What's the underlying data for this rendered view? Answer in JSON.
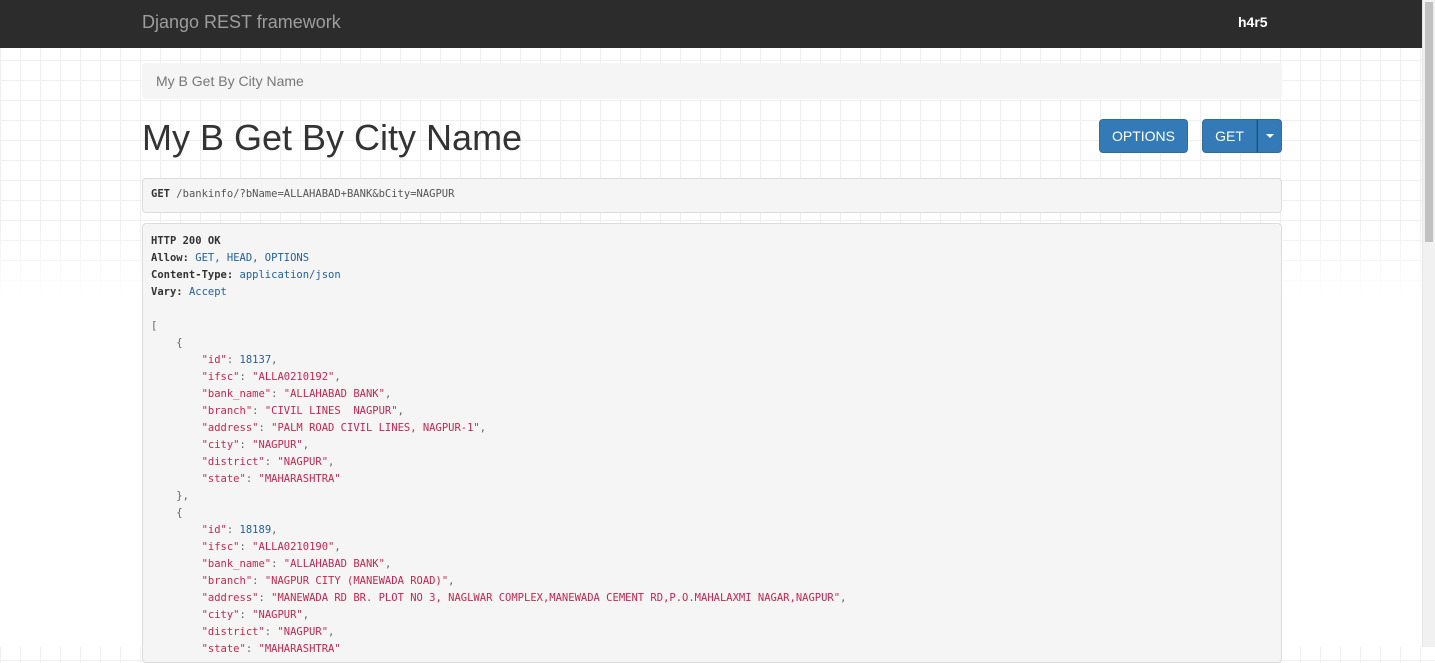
{
  "navbar": {
    "brand": "Django REST framework",
    "user": "h4r5"
  },
  "breadcrumb": {
    "label": "My B Get By City Name"
  },
  "page": {
    "title": "My B Get By City Name"
  },
  "buttons": {
    "options": "OPTIONS",
    "get": "GET"
  },
  "request": {
    "method": "GET",
    "url": "/bankinfo/?bName=ALLAHABAD+BANK&bCity=NAGPUR"
  },
  "response": {
    "status": "HTTP 200 OK",
    "headers": [
      {
        "key": "Allow:",
        "value": "GET, HEAD, OPTIONS"
      },
      {
        "key": "Content-Type:",
        "value": "application/json"
      },
      {
        "key": "Vary:",
        "value": "Accept"
      }
    ],
    "records": [
      {
        "id": "18137",
        "ifsc": "\"ALLA0210192\"",
        "bank_name": "\"ALLAHABAD BANK\"",
        "branch": "\"CIVIL LINES  NAGPUR\"",
        "address": "\"PALM ROAD CIVIL LINES, NAGPUR-1\"",
        "city": "\"NAGPUR\"",
        "district": "\"NAGPUR\"",
        "state": "\"MAHARASHTRA\""
      },
      {
        "id": "18189",
        "ifsc": "\"ALLA0210190\"",
        "bank_name": "\"ALLAHABAD BANK\"",
        "branch": "\"NAGPUR CITY (MANEWADA ROAD)\"",
        "address": "\"MANEWADA RD BR. PLOT NO 3, NAGLWAR COMPLEX,MANEWADA CEMENT RD,P.O.MAHALAXMI NAGAR,NAGPUR\"",
        "city": "\"NAGPUR\"",
        "district": "\"NAGPUR\"",
        "state": "\"MAHARASHTRA\""
      }
    ]
  },
  "colors": {
    "navbar": "#2c2c2c",
    "primary_button": "#337ab7",
    "json_string": "#c7254e",
    "json_number": "#1f5f9e"
  }
}
